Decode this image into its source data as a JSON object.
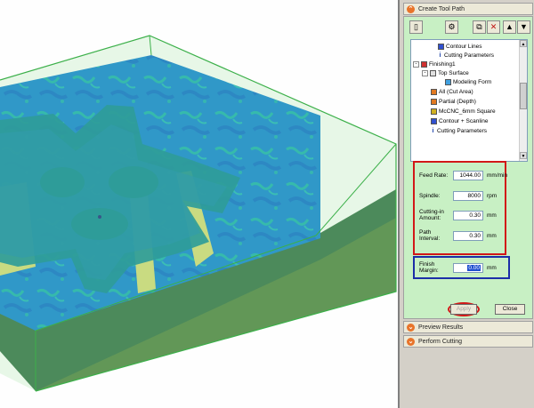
{
  "panel": {
    "sections": [
      {
        "label": "Create Tool Path",
        "state": "expanded"
      },
      {
        "label": "Preview Results",
        "state": "collapsed"
      },
      {
        "label": "Perform Cutting",
        "state": "collapsed"
      }
    ],
    "toolbar": {
      "new_icon": "new-document-icon",
      "toolpath_icon": "toolpath-wizard-icon",
      "copy_icon": "copy-icon",
      "delete_icon": "delete-icon",
      "up_icon": "move-up-icon",
      "down_icon": "move-down-icon"
    },
    "tree": [
      {
        "label": "Contour Lines",
        "indent": 3,
        "icon": "contour-icon"
      },
      {
        "label": "Cutting Parameters",
        "indent": 3,
        "icon": "info-icon"
      },
      {
        "label": "Finishing1",
        "indent": 0,
        "icon": "finishing-icon",
        "expander": "-"
      },
      {
        "label": "Top Surface",
        "indent": 1,
        "icon": "surface-icon",
        "expander": "-"
      },
      {
        "label": "Modeling Form",
        "indent": 3,
        "icon": "form-icon"
      },
      {
        "label": "All (Cut Area)",
        "indent": 2,
        "icon": "area-icon"
      },
      {
        "label": "Partial (Depth)",
        "indent": 2,
        "icon": "depth-icon"
      },
      {
        "label": "McCNC_6mm Square",
        "indent": 2,
        "icon": "tool-icon"
      },
      {
        "label": "Contour + Scanline",
        "indent": 2,
        "icon": "contour-icon"
      },
      {
        "label": "Cutting Parameters",
        "indent": 2,
        "icon": "info-icon"
      }
    ],
    "params": [
      {
        "label": "Feed Rate:",
        "value": "1044.00",
        "unit": "mm/min"
      },
      {
        "label": "Spindle:",
        "value": "8000",
        "unit": "rpm"
      },
      {
        "label": "Cutting-in Amount:",
        "value": "0.30",
        "unit": "mm"
      },
      {
        "label": "Path Interval:",
        "value": "0.30",
        "unit": "mm"
      }
    ],
    "finish": {
      "label": "Finish Margin:",
      "value": "0.00",
      "unit": "mm"
    },
    "buttons": {
      "apply": "Apply",
      "close": "Close"
    }
  },
  "colors": {
    "panel_green": "#c8f0c4",
    "highlight_red": "#d21818",
    "highlight_blue": "#1c2ea8",
    "stock_green": "#4caf50",
    "surface_blue": "#1f8ad8",
    "wall_teal": "#1d8f9f",
    "floor_yellow": "#d9dc82"
  }
}
